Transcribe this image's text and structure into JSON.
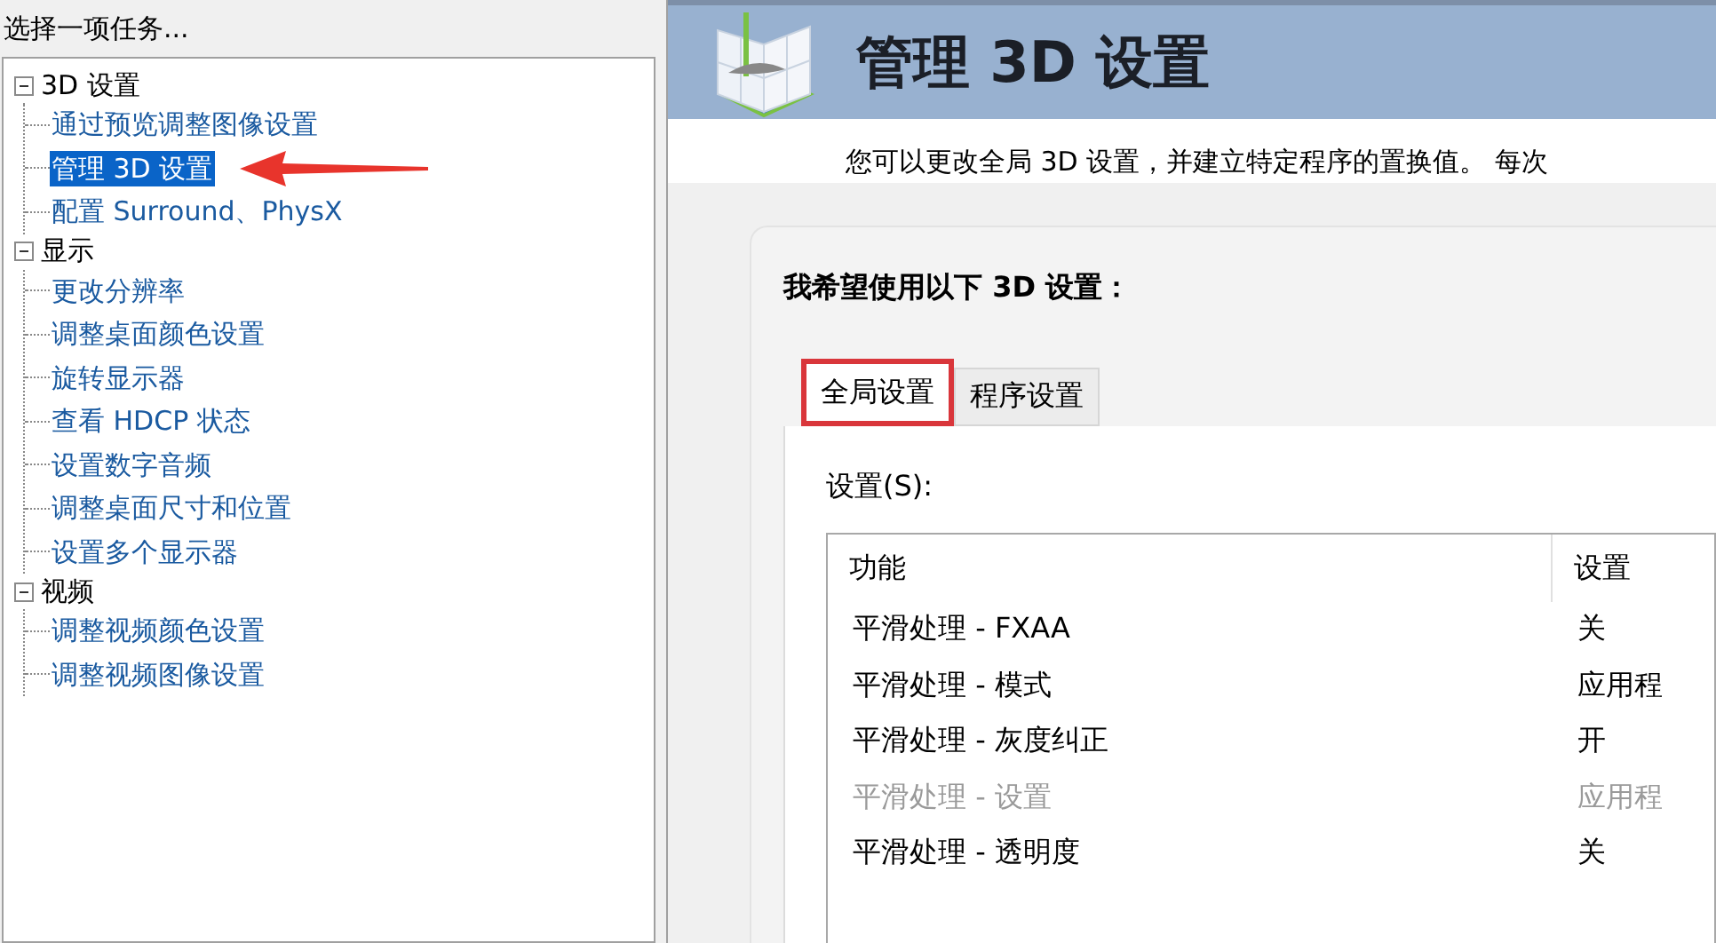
{
  "task_panel": {
    "title": "选择一项任务..."
  },
  "tree": [
    {
      "label": "3D 设置",
      "expanded": true,
      "children": [
        {
          "label": "通过预览调整图像设置",
          "selected": false,
          "annotated": false
        },
        {
          "label": "管理 3D 设置",
          "selected": true,
          "annotated": true
        },
        {
          "label": "配置 Surround、PhysX",
          "selected": false,
          "annotated": false
        }
      ]
    },
    {
      "label": "显示",
      "expanded": true,
      "children": [
        {
          "label": "更改分辨率",
          "selected": false,
          "annotated": false
        },
        {
          "label": "调整桌面颜色设置",
          "selected": false,
          "annotated": false
        },
        {
          "label": "旋转显示器",
          "selected": false,
          "annotated": false
        },
        {
          "label": "查看 HDCP 状态",
          "selected": false,
          "annotated": false
        },
        {
          "label": "设置数字音频",
          "selected": false,
          "annotated": false
        },
        {
          "label": "调整桌面尺寸和位置",
          "selected": false,
          "annotated": false
        },
        {
          "label": "设置多个显示器",
          "selected": false,
          "annotated": false
        }
      ]
    },
    {
      "label": "视频",
      "expanded": true,
      "children": [
        {
          "label": "调整视频颜色设置",
          "selected": false,
          "annotated": false
        },
        {
          "label": "调整视频图像设置",
          "selected": false,
          "annotated": false
        }
      ]
    }
  ],
  "page": {
    "title": "管理 3D 设置",
    "description": "您可以更改全局 3D 设置，并建立特定程序的置换值。 每次",
    "section_title": "我希望使用以下 3D 设置：",
    "tabs": [
      {
        "label": "全局设置",
        "selected": true,
        "highlighted": true
      },
      {
        "label": "程序设置",
        "selected": false,
        "highlighted": false
      }
    ],
    "settings_label": "设置(S):",
    "table": {
      "columns": [
        "功能",
        "设置"
      ],
      "rows": [
        {
          "feature": "平滑处理 - FXAA",
          "value": "关",
          "disabled": false
        },
        {
          "feature": "平滑处理 - 模式",
          "value": "应用程",
          "disabled": false
        },
        {
          "feature": "平滑处理 - 灰度纠正",
          "value": "开",
          "disabled": false
        },
        {
          "feature": "平滑处理 - 设置",
          "value": "应用程",
          "disabled": true
        },
        {
          "feature": "平滑处理 - 透明度",
          "value": "关",
          "disabled": false
        }
      ]
    }
  }
}
